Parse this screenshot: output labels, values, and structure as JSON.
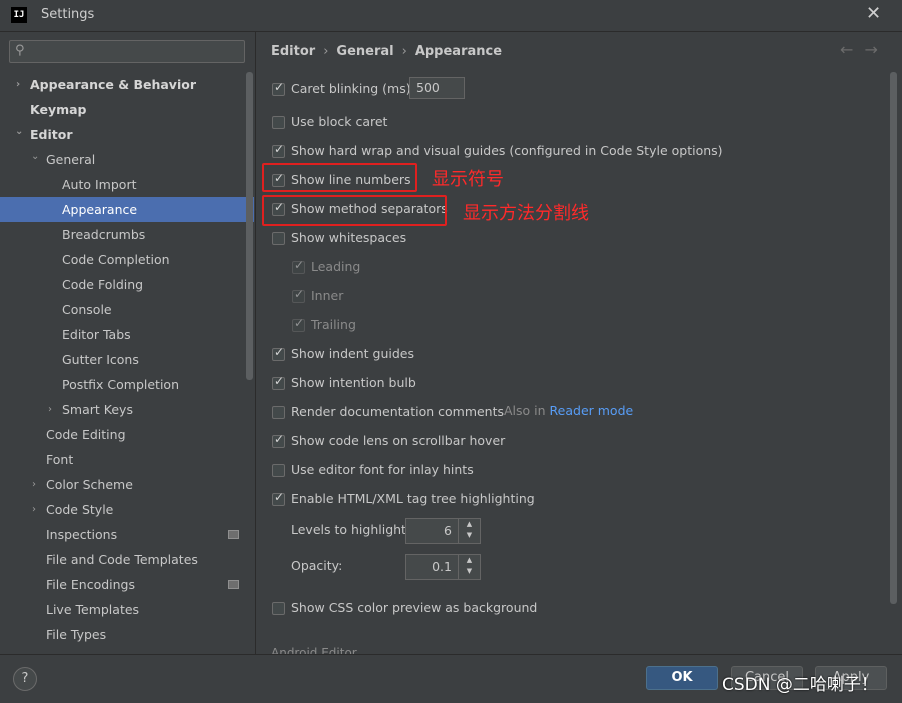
{
  "window": {
    "title": "Settings",
    "logo": "IJ",
    "close_icon": "close-icon"
  },
  "search": {
    "placeholder": "",
    "icon": "search-icon"
  },
  "sidebar": {
    "items": [
      {
        "label": "Appearance & Behavior",
        "bold": true,
        "chevron": "›"
      },
      {
        "label": "Keymap",
        "bold": true
      },
      {
        "label": "Editor",
        "bold": true,
        "chevron": "⌄"
      },
      {
        "label": "General",
        "chevron": "⌄"
      },
      {
        "label": "Auto Import"
      },
      {
        "label": "Appearance",
        "selected": true
      },
      {
        "label": "Breadcrumbs"
      },
      {
        "label": "Code Completion"
      },
      {
        "label": "Code Folding"
      },
      {
        "label": "Console"
      },
      {
        "label": "Editor Tabs"
      },
      {
        "label": "Gutter Icons"
      },
      {
        "label": "Postfix Completion"
      },
      {
        "label": "Smart Keys",
        "chevron": "›"
      },
      {
        "label": "Code Editing"
      },
      {
        "label": "Font"
      },
      {
        "label": "Color Scheme",
        "chevron": "›"
      },
      {
        "label": "Code Style",
        "chevron": "›"
      },
      {
        "label": "Inspections",
        "badge": true
      },
      {
        "label": "File and Code Templates"
      },
      {
        "label": "File Encodings",
        "badge": true
      },
      {
        "label": "Live Templates"
      },
      {
        "label": "File Types"
      }
    ]
  },
  "breadcrumb": {
    "items": [
      "Editor",
      "General",
      "Appearance"
    ],
    "separator": "›"
  },
  "nav": {
    "back": "←",
    "forward": "→"
  },
  "options": {
    "caret_blinking": {
      "label": "Caret blinking (ms):",
      "checked": true,
      "value": "500"
    },
    "block_caret": {
      "label": "Use block caret",
      "checked": false
    },
    "hard_wrap": {
      "label": "Show hard wrap and visual guides (configured in Code Style options)",
      "checked": true
    },
    "line_numbers": {
      "label": "Show line numbers",
      "checked": true
    },
    "method_separators": {
      "label": "Show method separators",
      "checked": true
    },
    "whitespaces": {
      "label": "Show whitespaces",
      "checked": false
    },
    "leading": {
      "label": "Leading",
      "checked": true
    },
    "inner": {
      "label": "Inner",
      "checked": true
    },
    "trailing": {
      "label": "Trailing",
      "checked": true
    },
    "indent_guides": {
      "label": "Show indent guides",
      "checked": true
    },
    "intention_bulb": {
      "label": "Show intention bulb",
      "checked": true
    },
    "render_docs": {
      "label": "Render documentation comments",
      "checked": false,
      "hint_prefix": "Also in",
      "hint_link": "Reader mode"
    },
    "code_lens": {
      "label": "Show code lens on scrollbar hover",
      "checked": true
    },
    "editor_font_hints": {
      "label": "Use editor font for inlay hints",
      "checked": false
    },
    "tag_highlighting": {
      "label": "Enable HTML/XML tag tree highlighting",
      "checked": true
    },
    "levels": {
      "label": "Levels to highlight:",
      "value": "6"
    },
    "opacity": {
      "label": "Opacity:",
      "value": "0.1"
    },
    "css_preview": {
      "label": "Show CSS color preview as background",
      "checked": false
    },
    "cutoff_section": {
      "label": "Android Editor"
    }
  },
  "annotations": {
    "line_numbers": "显示符号",
    "method_separators": "显示方法分割线"
  },
  "buttons": {
    "ok": "OK",
    "cancel": "Cancel",
    "apply": "Apply",
    "help": "?"
  },
  "watermark": "CSDN @二哈喇子！",
  "colors": {
    "selection": "#4b6eaf",
    "annotation": "#e0201f",
    "link": "#589df6",
    "ok_button": "#365880"
  }
}
